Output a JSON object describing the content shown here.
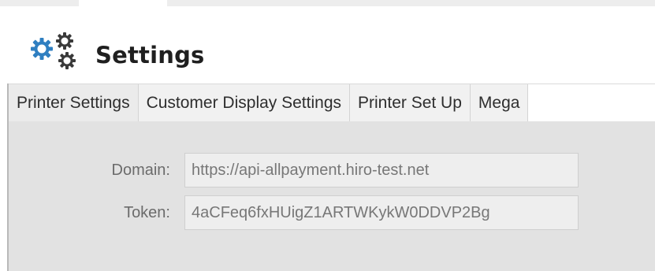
{
  "header": {
    "title": "Settings",
    "icon": "gears-icon"
  },
  "tabs": [
    {
      "label": "Printer Settings"
    },
    {
      "label": "Customer Display Settings"
    },
    {
      "label": "Printer Set Up"
    },
    {
      "label": "Mega"
    }
  ],
  "form": {
    "domain": {
      "label": "Domain:",
      "value": "https://api-allpayment.hiro-test.net"
    },
    "token": {
      "label": "Token:",
      "value": "4aCFeq6fxHUigZ1ARTWKykW0DDVP2Bg"
    }
  },
  "colors": {
    "icon_accent": "#2f7fc1",
    "icon_dark": "#3a3a3a",
    "panel_bg": "#e2e2e2"
  }
}
